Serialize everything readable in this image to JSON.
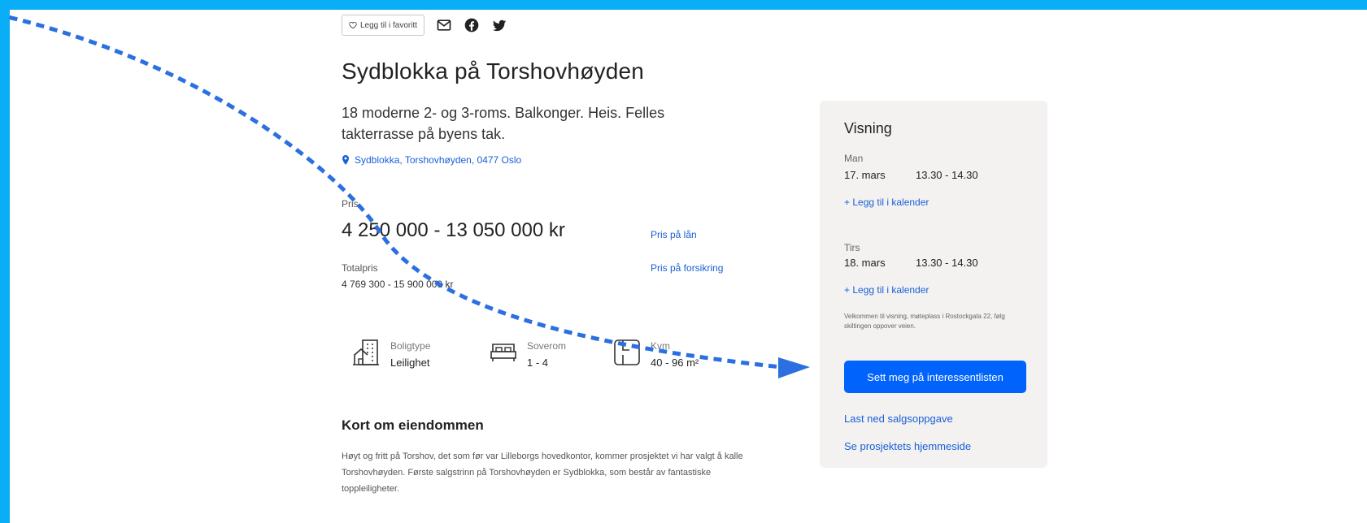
{
  "share": {
    "favorite_label": "Legg til i favoritt",
    "icons": [
      "heart-icon",
      "mail-icon",
      "facebook-icon",
      "twitter-icon"
    ]
  },
  "listing": {
    "title": "Sydblokka på Torshovhøyden",
    "subtitle": "18 moderne 2- og 3-roms. Balkonger. Heis. Felles takterrasse på byens tak.",
    "address": "Sydblokka, Torshovhøyden, 0477 Oslo",
    "price_label": "Pris",
    "price": "4 250 000 - 13 050 000 kr",
    "loan_link": "Pris på lån",
    "total_label": "Totalpris",
    "total_value": "4 769 300 - 15 900 000 kr",
    "insurance_link": "Pris på forsikring"
  },
  "facts": [
    {
      "key": "Boligtype",
      "value": "Leilighet",
      "icon": "building-icon"
    },
    {
      "key": "Soverom",
      "value": "1 - 4",
      "icon": "bed-icon"
    },
    {
      "key": "Kvm",
      "value": "40 - 96 m²",
      "icon": "floorplan-icon"
    }
  ],
  "about": {
    "title": "Kort om eiendommen",
    "text": "Høyt og fritt på Torshov, det som før var Lilleborgs hovedkontor, kommer prosjektet vi har valgt å kalle Torshovhøyden. Første salgstrinn på Torshovhøyden er Sydblokka, som består av fantastiske toppleiligheter."
  },
  "viewing": {
    "title": "Visning",
    "slots": [
      {
        "day": "Man",
        "date": "17. mars",
        "time": "13.30 - 14.30",
        "calendar": "+ Legg til i kalender"
      },
      {
        "day": "Tirs",
        "date": "18. mars",
        "time": "13.30 - 14.30",
        "calendar": "+ Legg til i kalender"
      }
    ],
    "note": "Velkommen til visning, møteplass i Rostockgata 22, følg skiltingen oppover veien.",
    "cta": "Sett meg på interessentlisten",
    "download_link": "Last ned salgsoppgave",
    "homepage_link": "Se prosjektets hjemmeside"
  },
  "colors": {
    "frame": "#0aaef7",
    "link": "#1a5fd6",
    "cta": "#0063fb",
    "panel": "#f3f2f1",
    "annotation": "#2b6fe0"
  }
}
